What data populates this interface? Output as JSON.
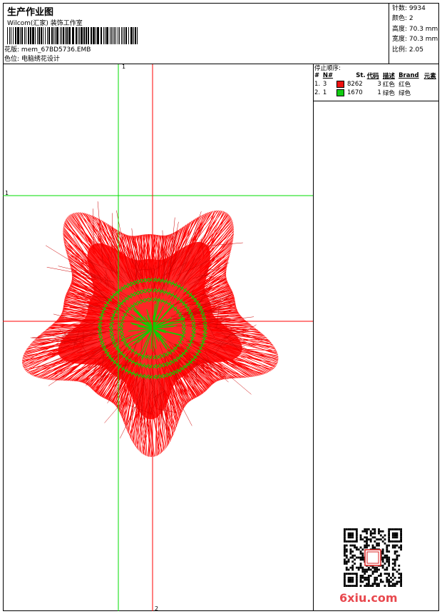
{
  "header": {
    "title": "生产作业图",
    "company": "Wilcom(汇家) 装饰工作室",
    "design_label": "花版:",
    "design_name": "mem_67BD5736.EMB",
    "color_label": "色位:",
    "color_value": "电脑绣花设计"
  },
  "stats": {
    "stitches": "针数: 9934",
    "colors": "颜色: 2",
    "height": "高度: 70.3 mm",
    "width": "宽度: 70.3 mm",
    "ratio": "比例: 2.05"
  },
  "stop_sequence": {
    "caption": "停止顺序:",
    "headers": {
      "num": "#",
      "no": "N#",
      "st": "St.",
      "code": "代码",
      "desc": "描述",
      "brand": "Brand",
      "element": "元素"
    },
    "rows": [
      {
        "num": "1.",
        "no": "3",
        "color": "#ee1111",
        "st": "8262",
        "code": "3",
        "desc": "红色",
        "brand": "红色"
      },
      {
        "num": "2.",
        "no": "1",
        "color": "#11cc11",
        "st": "1670",
        "code": "1",
        "desc": "绿色",
        "brand": "绿色"
      }
    ]
  },
  "guides": {
    "vertical_top": "1",
    "vertical_bottom": "2",
    "horizontal_left": "1"
  },
  "colors": {
    "red": "#ff0000",
    "green": "#11cc00",
    "guide_green": "#00dd00",
    "guide_red": "#ff0000"
  },
  "watermark": "6xiu.com"
}
